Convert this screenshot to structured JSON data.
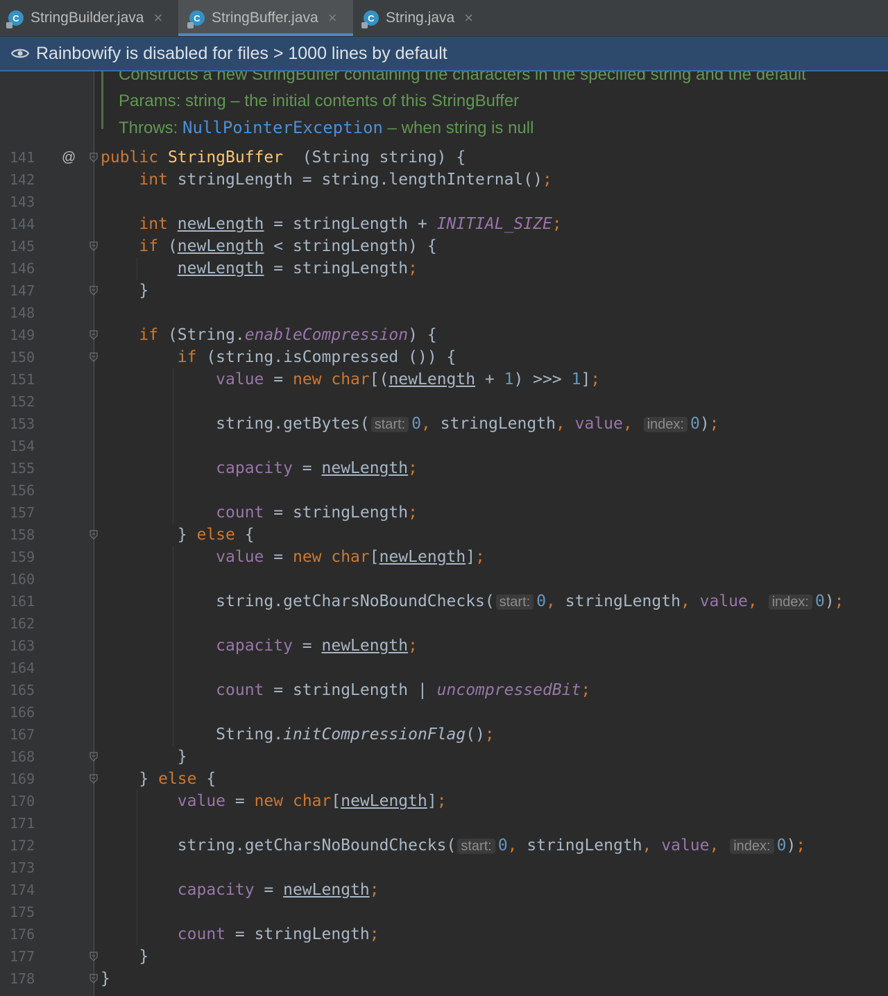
{
  "tabs": [
    {
      "label": "StringBuilder.java",
      "icon": "java-class-icon",
      "active": false
    },
    {
      "label": "StringBuffer.java",
      "icon": "java-class-icon",
      "active": true
    },
    {
      "label": "String.java",
      "icon": "java-class-icon",
      "active": false
    }
  ],
  "banner": {
    "text": "Rainbowify is disabled for files > 1000 lines by default",
    "icon": "eye-icon"
  },
  "doc": {
    "line1": "Constructs a new StringBuffer containing the characters in the specified string and the default",
    "params_prefix": "Params: string – the initial contents of this StringBuffer",
    "throws_prefix": "Throws: ",
    "throws_link": "NullPointerException",
    "throws_suffix": " – when string is null"
  },
  "gutter": {
    "override_marker": "@"
  },
  "lines": [
    {
      "n": "141",
      "tokens": [
        [
          "kw",
          "public "
        ],
        [
          "cls",
          "StringBuffer"
        ],
        [
          "",
          "  (String string) {"
        ]
      ]
    },
    {
      "n": "142",
      "tokens": [
        [
          "",
          "    "
        ],
        [
          "kw",
          "int "
        ],
        [
          "",
          "stringLength = string.lengthInternal()"
        ],
        [
          "kw",
          ";"
        ]
      ]
    },
    {
      "n": "143",
      "tokens": []
    },
    {
      "n": "144",
      "tokens": [
        [
          "",
          "    "
        ],
        [
          "kw",
          "int "
        ],
        [
          "ul",
          "newLength"
        ],
        [
          "",
          " = stringLength + "
        ],
        [
          "sfi",
          "INITIAL_SIZE"
        ],
        [
          "kw",
          ";"
        ]
      ]
    },
    {
      "n": "145",
      "tokens": [
        [
          "",
          "    "
        ],
        [
          "kw",
          "if "
        ],
        [
          "",
          "("
        ],
        [
          "ul",
          "newLength"
        ],
        [
          "",
          " < stringLength) {"
        ]
      ]
    },
    {
      "n": "146",
      "tokens": [
        [
          "",
          "        "
        ],
        [
          "ul",
          "newLength"
        ],
        [
          "",
          " = stringLength"
        ],
        [
          "kw",
          ";"
        ]
      ]
    },
    {
      "n": "147",
      "tokens": [
        [
          "",
          "    }"
        ]
      ]
    },
    {
      "n": "148",
      "tokens": []
    },
    {
      "n": "149",
      "tokens": [
        [
          "",
          "    "
        ],
        [
          "kw",
          "if "
        ],
        [
          "",
          "(String."
        ],
        [
          "sfi",
          "enableCompression"
        ],
        [
          "",
          ") {"
        ]
      ]
    },
    {
      "n": "150",
      "tokens": [
        [
          "",
          "        "
        ],
        [
          "kw",
          "if "
        ],
        [
          "",
          "(string.isCompressed ()) {"
        ]
      ]
    },
    {
      "n": "151",
      "tokens": [
        [
          "",
          "            "
        ],
        [
          "fld",
          "value"
        ],
        [
          "",
          " = "
        ],
        [
          "kw",
          "new char"
        ],
        [
          "",
          "[("
        ],
        [
          "ul",
          "newLength"
        ],
        [
          "",
          " + "
        ],
        [
          "num",
          "1"
        ],
        [
          "",
          ") >>> "
        ],
        [
          "num",
          "1"
        ],
        [
          "",
          "]"
        ],
        [
          "kw",
          ";"
        ]
      ]
    },
    {
      "n": "152",
      "tokens": []
    },
    {
      "n": "153",
      "tokens": [
        [
          "",
          "            string.getBytes("
        ],
        [
          "hint",
          "start:"
        ],
        [
          "num",
          "0"
        ],
        [
          "kw",
          ", "
        ],
        [
          "",
          "stringLength"
        ],
        [
          "kw",
          ", "
        ],
        [
          "fld",
          "value"
        ],
        [
          "kw",
          ", "
        ],
        [
          "hint",
          "index:"
        ],
        [
          "num",
          "0"
        ],
        [
          "",
          ")"
        ],
        [
          "kw",
          ";"
        ]
      ]
    },
    {
      "n": "154",
      "tokens": []
    },
    {
      "n": "155",
      "tokens": [
        [
          "",
          "            "
        ],
        [
          "fld",
          "capacity"
        ],
        [
          "",
          " = "
        ],
        [
          "ul",
          "newLength"
        ],
        [
          "kw",
          ";"
        ]
      ]
    },
    {
      "n": "156",
      "tokens": []
    },
    {
      "n": "157",
      "tokens": [
        [
          "",
          "            "
        ],
        [
          "fld",
          "count"
        ],
        [
          "",
          " = stringLength"
        ],
        [
          "kw",
          ";"
        ]
      ]
    },
    {
      "n": "158",
      "tokens": [
        [
          "",
          "        } "
        ],
        [
          "kw",
          "else "
        ],
        [
          "",
          "{"
        ]
      ]
    },
    {
      "n": "159",
      "tokens": [
        [
          "",
          "            "
        ],
        [
          "fld",
          "value"
        ],
        [
          "",
          " = "
        ],
        [
          "kw",
          "new char"
        ],
        [
          "",
          "["
        ],
        [
          "ul",
          "newLength"
        ],
        [
          "",
          "]"
        ],
        [
          "kw",
          ";"
        ]
      ]
    },
    {
      "n": "160",
      "tokens": []
    },
    {
      "n": "161",
      "tokens": [
        [
          "",
          "            string.getCharsNoBoundChecks("
        ],
        [
          "hint",
          "start:"
        ],
        [
          "num",
          "0"
        ],
        [
          "kw",
          ", "
        ],
        [
          "",
          "stringLength"
        ],
        [
          "kw",
          ", "
        ],
        [
          "fld",
          "value"
        ],
        [
          "kw",
          ", "
        ],
        [
          "hint",
          "index:"
        ],
        [
          "num",
          "0"
        ],
        [
          "",
          ")"
        ],
        [
          "kw",
          ";"
        ]
      ]
    },
    {
      "n": "162",
      "tokens": []
    },
    {
      "n": "163",
      "tokens": [
        [
          "",
          "            "
        ],
        [
          "fld",
          "capacity"
        ],
        [
          "",
          " = "
        ],
        [
          "ul",
          "newLength"
        ],
        [
          "kw",
          ";"
        ]
      ]
    },
    {
      "n": "164",
      "tokens": []
    },
    {
      "n": "165",
      "tokens": [
        [
          "",
          "            "
        ],
        [
          "fld",
          "count"
        ],
        [
          "",
          " = stringLength | "
        ],
        [
          "sfi",
          "uncompressedBit"
        ],
        [
          "kw",
          ";"
        ]
      ]
    },
    {
      "n": "166",
      "tokens": []
    },
    {
      "n": "167",
      "tokens": [
        [
          "",
          "            String."
        ],
        [
          "it",
          "initCompressionFlag"
        ],
        [
          "",
          "()"
        ],
        [
          "kw",
          ";"
        ]
      ]
    },
    {
      "n": "168",
      "tokens": [
        [
          "",
          "        }"
        ]
      ]
    },
    {
      "n": "169",
      "tokens": [
        [
          "",
          "    } "
        ],
        [
          "kw",
          "else "
        ],
        [
          "",
          "{"
        ]
      ]
    },
    {
      "n": "170",
      "tokens": [
        [
          "",
          "        "
        ],
        [
          "fld",
          "value"
        ],
        [
          "",
          " = "
        ],
        [
          "kw",
          "new char"
        ],
        [
          "",
          "["
        ],
        [
          "ul",
          "newLength"
        ],
        [
          "",
          "]"
        ],
        [
          "kw",
          ";"
        ]
      ]
    },
    {
      "n": "171",
      "tokens": []
    },
    {
      "n": "172",
      "tokens": [
        [
          "",
          "        string.getCharsNoBoundChecks("
        ],
        [
          "hint",
          "start:"
        ],
        [
          "num",
          "0"
        ],
        [
          "kw",
          ", "
        ],
        [
          "",
          "stringLength"
        ],
        [
          "kw",
          ", "
        ],
        [
          "fld",
          "value"
        ],
        [
          "kw",
          ", "
        ],
        [
          "hint",
          "index:"
        ],
        [
          "num",
          "0"
        ],
        [
          "",
          ")"
        ],
        [
          "kw",
          ";"
        ]
      ]
    },
    {
      "n": "173",
      "tokens": []
    },
    {
      "n": "174",
      "tokens": [
        [
          "",
          "        "
        ],
        [
          "fld",
          "capacity"
        ],
        [
          "",
          " = "
        ],
        [
          "ul",
          "newLength"
        ],
        [
          "kw",
          ";"
        ]
      ]
    },
    {
      "n": "175",
      "tokens": []
    },
    {
      "n": "176",
      "tokens": [
        [
          "",
          "        "
        ],
        [
          "fld",
          "count"
        ],
        [
          "",
          " = stringLength"
        ],
        [
          "kw",
          ";"
        ]
      ]
    },
    {
      "n": "177",
      "tokens": [
        [
          "",
          "    }"
        ]
      ]
    },
    {
      "n": "178",
      "tokens": [
        [
          "",
          "}"
        ]
      ]
    }
  ],
  "colors": {
    "background": "#2b2b2b",
    "keyword": "#cc7832",
    "method_decl": "#ffc66d",
    "field": "#9876aa",
    "number": "#6897bb",
    "doc": "#629755",
    "banner": "#2d4a6d"
  }
}
